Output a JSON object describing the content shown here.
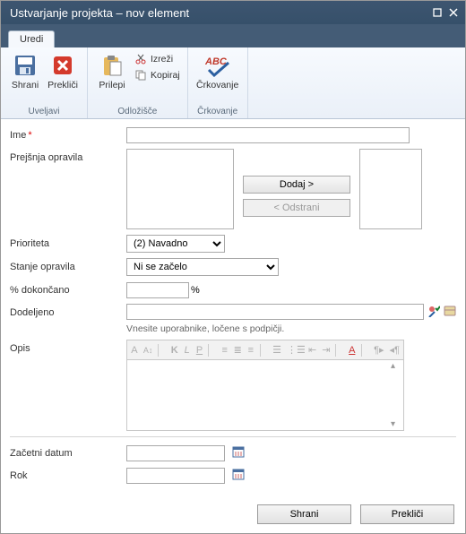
{
  "window": {
    "title": "Ustvarjanje projekta – nov element"
  },
  "tabs": {
    "edit": "Uredi"
  },
  "ribbon": {
    "group_commit_label": "Uveljavi",
    "save": "Shrani",
    "cancel": "Prekliči",
    "group_clipboard_label": "Odložišče",
    "paste": "Prilepi",
    "cut": "Izreži",
    "copy": "Kopiraj",
    "group_spell_label": "Črkovanje",
    "spell": "Črkovanje"
  },
  "form": {
    "name_label": "Ime",
    "name_value": "",
    "predecessors_label": "Prejšnja opravila",
    "add_btn": "Dodaj >",
    "remove_btn": "< Odstrani",
    "priority_label": "Prioriteta",
    "priority_value": "(2) Navadno",
    "status_label": "Stanje opravila",
    "status_value": "Ni se začelo",
    "percent_label": "% dokončano",
    "percent_value": "",
    "percent_suffix": "%",
    "assigned_label": "Dodeljeno",
    "assigned_value": "",
    "assigned_hint": "Vnesite uporabnike, ločene s podpičji.",
    "desc_label": "Opis",
    "startdate_label": "Začetni datum",
    "startdate_value": "",
    "duedate_label": "Rok",
    "duedate_value": ""
  },
  "footer": {
    "save": "Shrani",
    "cancel": "Prekliči"
  }
}
